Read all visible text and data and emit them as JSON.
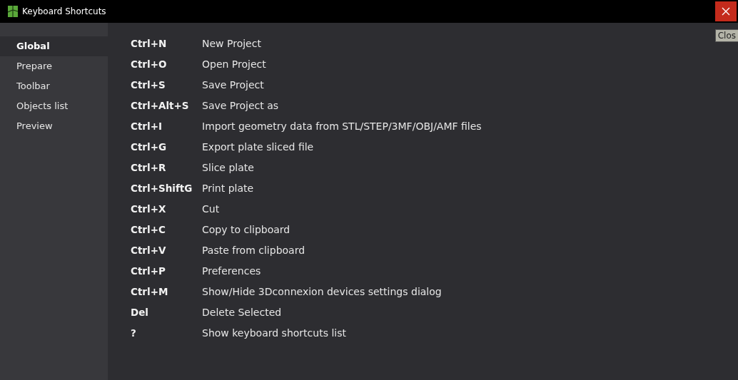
{
  "window": {
    "title": "Keyboard Shortcuts"
  },
  "tooltip": "Clos",
  "sidebar": {
    "items": [
      {
        "label": "Global",
        "selected": true
      },
      {
        "label": "Prepare",
        "selected": false
      },
      {
        "label": "Toolbar",
        "selected": false
      },
      {
        "label": "Objects list",
        "selected": false
      },
      {
        "label": "Preview",
        "selected": false
      }
    ]
  },
  "shortcuts": [
    {
      "key": "Ctrl+N",
      "action": "New Project"
    },
    {
      "key": "Ctrl+O",
      "action": "Open Project"
    },
    {
      "key": "Ctrl+S",
      "action": "Save Project"
    },
    {
      "key": "Ctrl+Alt+S",
      "action": "Save Project as"
    },
    {
      "key": "Ctrl+I",
      "action": "Import geometry data from STL/STEP/3MF/OBJ/AMF files"
    },
    {
      "key": "Ctrl+G",
      "action": "Export plate sliced file"
    },
    {
      "key": "Ctrl+R",
      "action": "Slice plate"
    },
    {
      "key": "Ctrl+ShiftG",
      "action": "Print plate"
    },
    {
      "key": "Ctrl+X",
      "action": "Cut"
    },
    {
      "key": "Ctrl+C",
      "action": "Copy to clipboard"
    },
    {
      "key": "Ctrl+V",
      "action": "Paste from clipboard"
    },
    {
      "key": "Ctrl+P",
      "action": "Preferences"
    },
    {
      "key": "Ctrl+M",
      "action": "Show/Hide 3Dconnexion devices settings dialog"
    },
    {
      "key": "Del",
      "action": "Delete Selected"
    },
    {
      "key": "?",
      "action": "Show keyboard shortcuts list"
    }
  ]
}
